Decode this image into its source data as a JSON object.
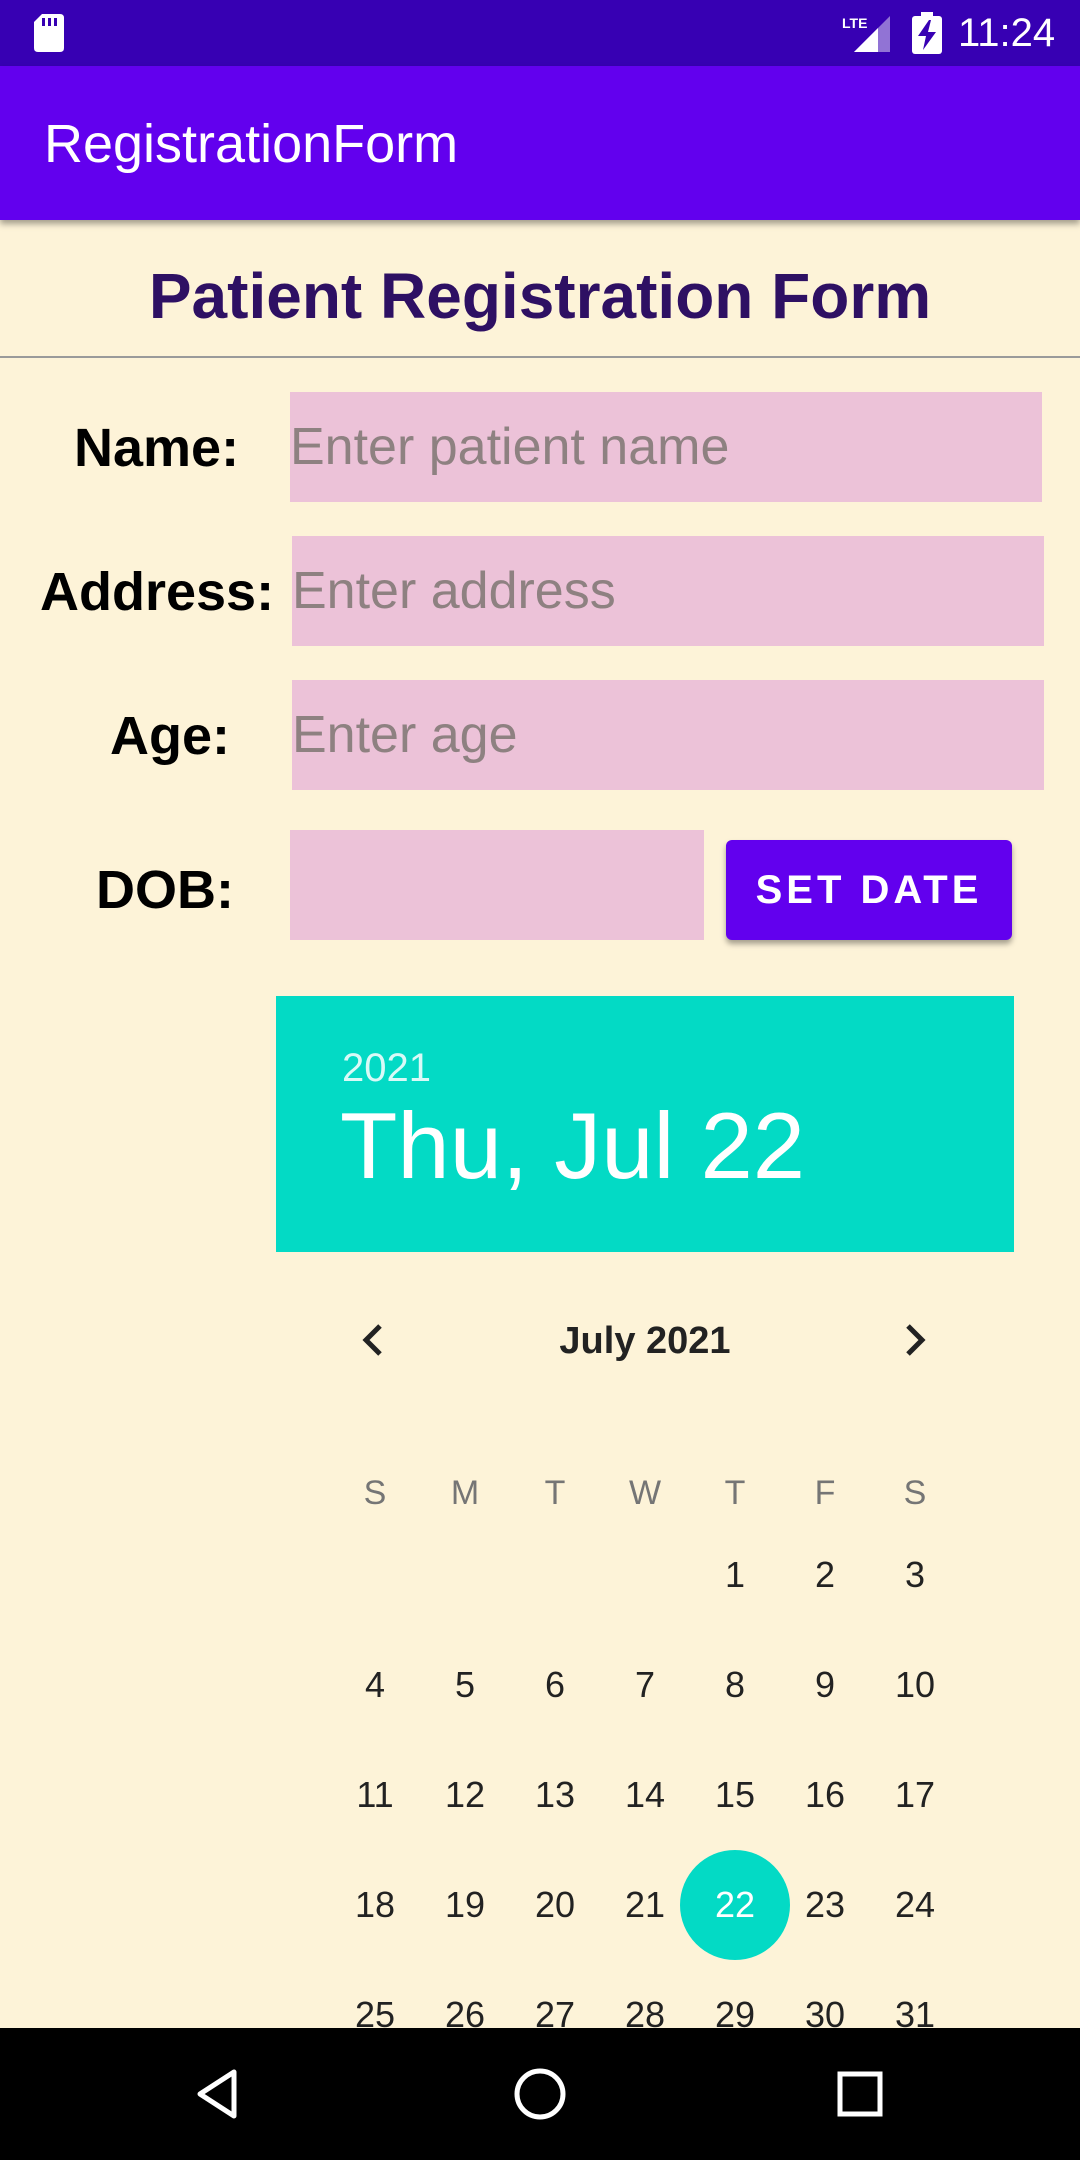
{
  "status_bar": {
    "time": "11:24",
    "network": "LTE",
    "icons": [
      "sd-card-icon",
      "signal-icon",
      "battery-charging-icon"
    ]
  },
  "app_bar": {
    "title": "RegistrationForm"
  },
  "form": {
    "title": "Patient Registration Form",
    "name_label": "Name:",
    "name_placeholder": "Enter patient name",
    "address_label": "Address:",
    "address_placeholder": "Enter address",
    "age_label": "Age:",
    "age_placeholder": "Enter age",
    "dob_label": "DOB:",
    "dob_value": "",
    "set_date_label": "SET DATE"
  },
  "date_picker": {
    "header_year": "2021",
    "header_date": "Thu, Jul 22",
    "month_title": "July 2021",
    "weekdays": [
      "S",
      "M",
      "T",
      "W",
      "T",
      "F",
      "S"
    ],
    "days": [
      "1",
      "2",
      "3",
      "4",
      "5",
      "6",
      "7",
      "8",
      "9",
      "10",
      "11",
      "12",
      "13",
      "14",
      "15",
      "16",
      "17",
      "18",
      "19",
      "20",
      "21",
      "22",
      "23",
      "24",
      "25",
      "26",
      "27",
      "28",
      "29",
      "30",
      "31"
    ],
    "first_weekday_index": 4,
    "selected_day": "22",
    "accent_color": "#03dac5"
  },
  "colors": {
    "primary": "#6200ee",
    "primary_dark": "#3700b3",
    "background": "#fdf3d8",
    "field_bg": "#ecc2d8",
    "title_text": "#2e1063"
  },
  "nav_bar": {
    "icons": [
      "back-icon",
      "home-icon",
      "recents-icon"
    ]
  }
}
